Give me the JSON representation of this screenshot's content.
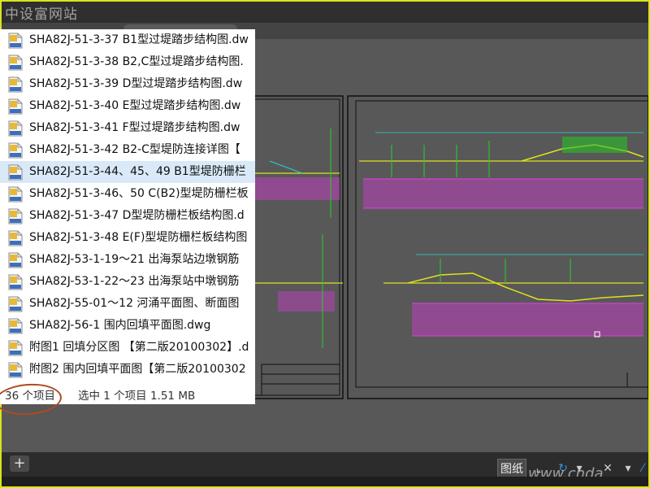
{
  "watermark_top": "中设富网站",
  "watermark_bottom": "www.cnda",
  "colors": {
    "frame": "#d7e51c",
    "drawing_bg": "#585858",
    "annotation_ring": "#b24a1f",
    "selected_row": "#d9e9f8"
  },
  "explorer": {
    "files": [
      {
        "name": "SHA82J-51-3-37 B1型过堤踏步结构图.dw",
        "icon": "dwg-file-icon"
      },
      {
        "name": "SHA82J-51-3-38 B2,C型过堤踏步结构图.",
        "icon": "dwg-file-icon"
      },
      {
        "name": "SHA82J-51-3-39 D型过堤踏步结构图.dw",
        "icon": "dwg-file-icon"
      },
      {
        "name": "SHA82J-51-3-40 E型过堤踏步结构图.dw",
        "icon": "dwg-file-icon"
      },
      {
        "name": "SHA82J-51-3-41 F型过堤踏步结构图.dw",
        "icon": "dwg-file-icon"
      },
      {
        "name": "SHA82J-51-3-42 B2-C型堤防连接详图【",
        "icon": "dwg-file-icon"
      },
      {
        "name": "SHA82J-51-3-44、45、49 B1型堤防栅栏",
        "icon": "dwg-file-icon",
        "selected": true
      },
      {
        "name": "SHA82J-51-3-46、50 C(B2)型堤防栅栏板",
        "icon": "dwg-file-icon"
      },
      {
        "name": "SHA82J-51-3-47 D型堤防栅栏板结构图.d",
        "icon": "dwg-file-icon"
      },
      {
        "name": "SHA82J-51-3-48 E(F)型堤防栅栏板结构图",
        "icon": "dwg-file-icon"
      },
      {
        "name": "SHA82J-53-1-19～21 出海泵站边墩钢筋",
        "icon": "dwg-file-icon"
      },
      {
        "name": "SHA82J-53-1-22～23 出海泵站中墩钢筋",
        "icon": "dwg-file-icon"
      },
      {
        "name": "SHA82J-55-01～12 河涌平面图、断面图",
        "icon": "dwg-file-icon"
      },
      {
        "name": "SHA82J-56-1 围内回填平面图.dwg",
        "icon": "dwg-file-icon"
      },
      {
        "name": "附图1 回填分区图 【第二版20100302】.d",
        "icon": "dwg-file-icon"
      },
      {
        "name": "附图2 围内回填平面图【第二版20100302",
        "icon": "dwg-file-icon"
      }
    ],
    "status": {
      "item_count": "36 个项目",
      "selection": "选中 1 个项目  1.51 MB"
    }
  },
  "bottombar": {
    "add_label": "+",
    "paper_label": "图纸"
  }
}
